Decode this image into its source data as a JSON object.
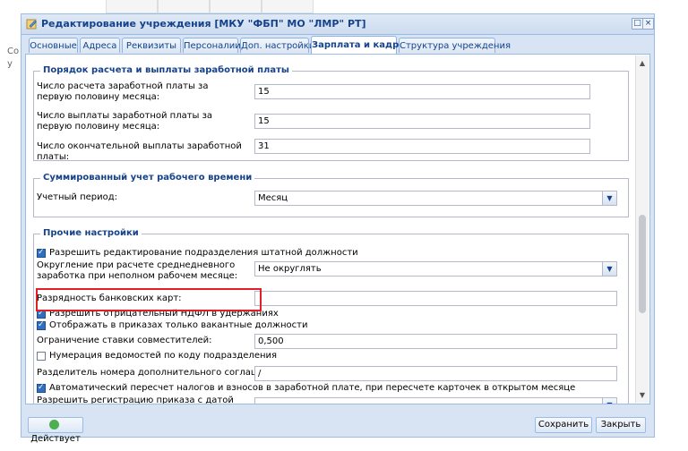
{
  "background": {
    "side_text_1": "Co",
    "side_text_2": "у"
  },
  "window": {
    "title": "Редактирование учреждения [МКУ \"ФБП\" МО \"ЛМР\" РТ]",
    "tabs": [
      {
        "label": "Основные"
      },
      {
        "label": "Адреса"
      },
      {
        "label": "Реквизиты"
      },
      {
        "label": "Персоналии"
      },
      {
        "label": "Доп. настройки"
      },
      {
        "label": "Зарплата и кадры"
      },
      {
        "label": "Структура учреждения"
      }
    ]
  },
  "salary_section": {
    "legend": "Порядок расчета и выплаты заработной платы",
    "rows": [
      {
        "label": "Число расчета заработной платы за первую половину месяца:",
        "value": "15"
      },
      {
        "label": "Число выплаты заработной платы за первую половину месяца:",
        "value": "15"
      },
      {
        "label": "Число окончательной выплаты заработной платы:",
        "value": "31"
      }
    ]
  },
  "worktime_section": {
    "legend": "Суммированный учет рабочего времени",
    "period_label": "Учетный период:",
    "period_value": "Месяц"
  },
  "other_section": {
    "legend": "Прочие настройки",
    "allow_edit_label": "Разрешить редактирование подразделения штатной должности",
    "rounding_label": "Округление при расчете среднедневного заработка при неполном рабочем месяце:",
    "rounding_value": "Не округлять",
    "bank_digits_label": "Разрядность банковских карт:",
    "bank_digits_value": "",
    "negative_ndfl_label": "Разрешить отрицательный НДФЛ в удержаниях",
    "vacant_only_label": "Отображать в приказах только вакантные должности",
    "combo_limit_label": "Ограничение ставки совместителей:",
    "combo_limit_value": "0,500",
    "numbering_label": "Нумерация ведомостей по коду подразделения",
    "separator_label": "Разделитель номера дополнительного соглашения:",
    "separator_value": "/",
    "auto_recalc_label": "Автоматический пересчет налогов и взносов в заработной плате, при пересчете карточек в открытом месяце",
    "allow_late_label": "Разрешить регистрацию приказа с датой создания позднее периода приказа для:",
    "allow_late_value": ""
  },
  "footer": {
    "status_label": "Действует",
    "save_label": "Сохранить",
    "close_label": "Закрыть"
  },
  "colors": {
    "highlight": "#e01f26",
    "title": "#15428b"
  }
}
